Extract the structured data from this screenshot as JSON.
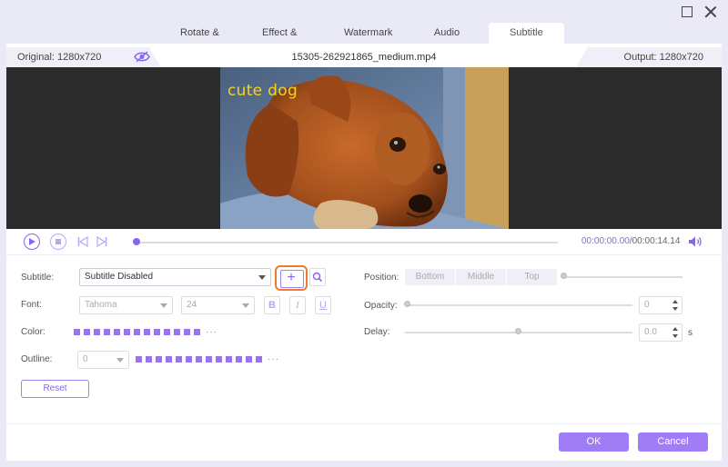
{
  "tabs": [
    {
      "label": "Rotate & Crop"
    },
    {
      "label": "Effect & Filter"
    },
    {
      "label": "Watermark"
    },
    {
      "label": "Audio"
    },
    {
      "label": "Subtitle",
      "active": true
    }
  ],
  "info": {
    "original": "Original: 1280x720",
    "filename": "15305-262921865_medium.mp4",
    "output": "Output: 1280x720"
  },
  "preview": {
    "subtitle_text": "cute dog"
  },
  "player": {
    "current_time": "00:00:00.00",
    "total_time": "/00:00:14.14",
    "progress": 0
  },
  "subtitle": {
    "label": "Subtitle:",
    "value": "Subtitle Disabled",
    "add_symbol": "+"
  },
  "font": {
    "label": "Font:",
    "family": "Tahoma",
    "size": "24",
    "bold": "B",
    "italic": "I",
    "underline": "U"
  },
  "color": {
    "label": "Color:",
    "swatch_color": "#9a74ef",
    "swatch_count": 13,
    "more": "···"
  },
  "outline": {
    "label": "Outline:",
    "value": "0",
    "swatch_count": 13,
    "more": "···"
  },
  "reset_label": "Reset",
  "position": {
    "label": "Position:",
    "options": [
      "Bottom",
      "Middle",
      "Top"
    ]
  },
  "opacity": {
    "label": "Opacity:",
    "value": "0"
  },
  "delay": {
    "label": "Delay:",
    "value": "0.0",
    "unit": "s"
  },
  "footer": {
    "ok_label": "OK",
    "cancel_label": "Cancel"
  },
  "colors": {
    "accent": "#8a63f5",
    "highlight": "#ef7a2e",
    "subtitle_text": "#f5d31e"
  }
}
